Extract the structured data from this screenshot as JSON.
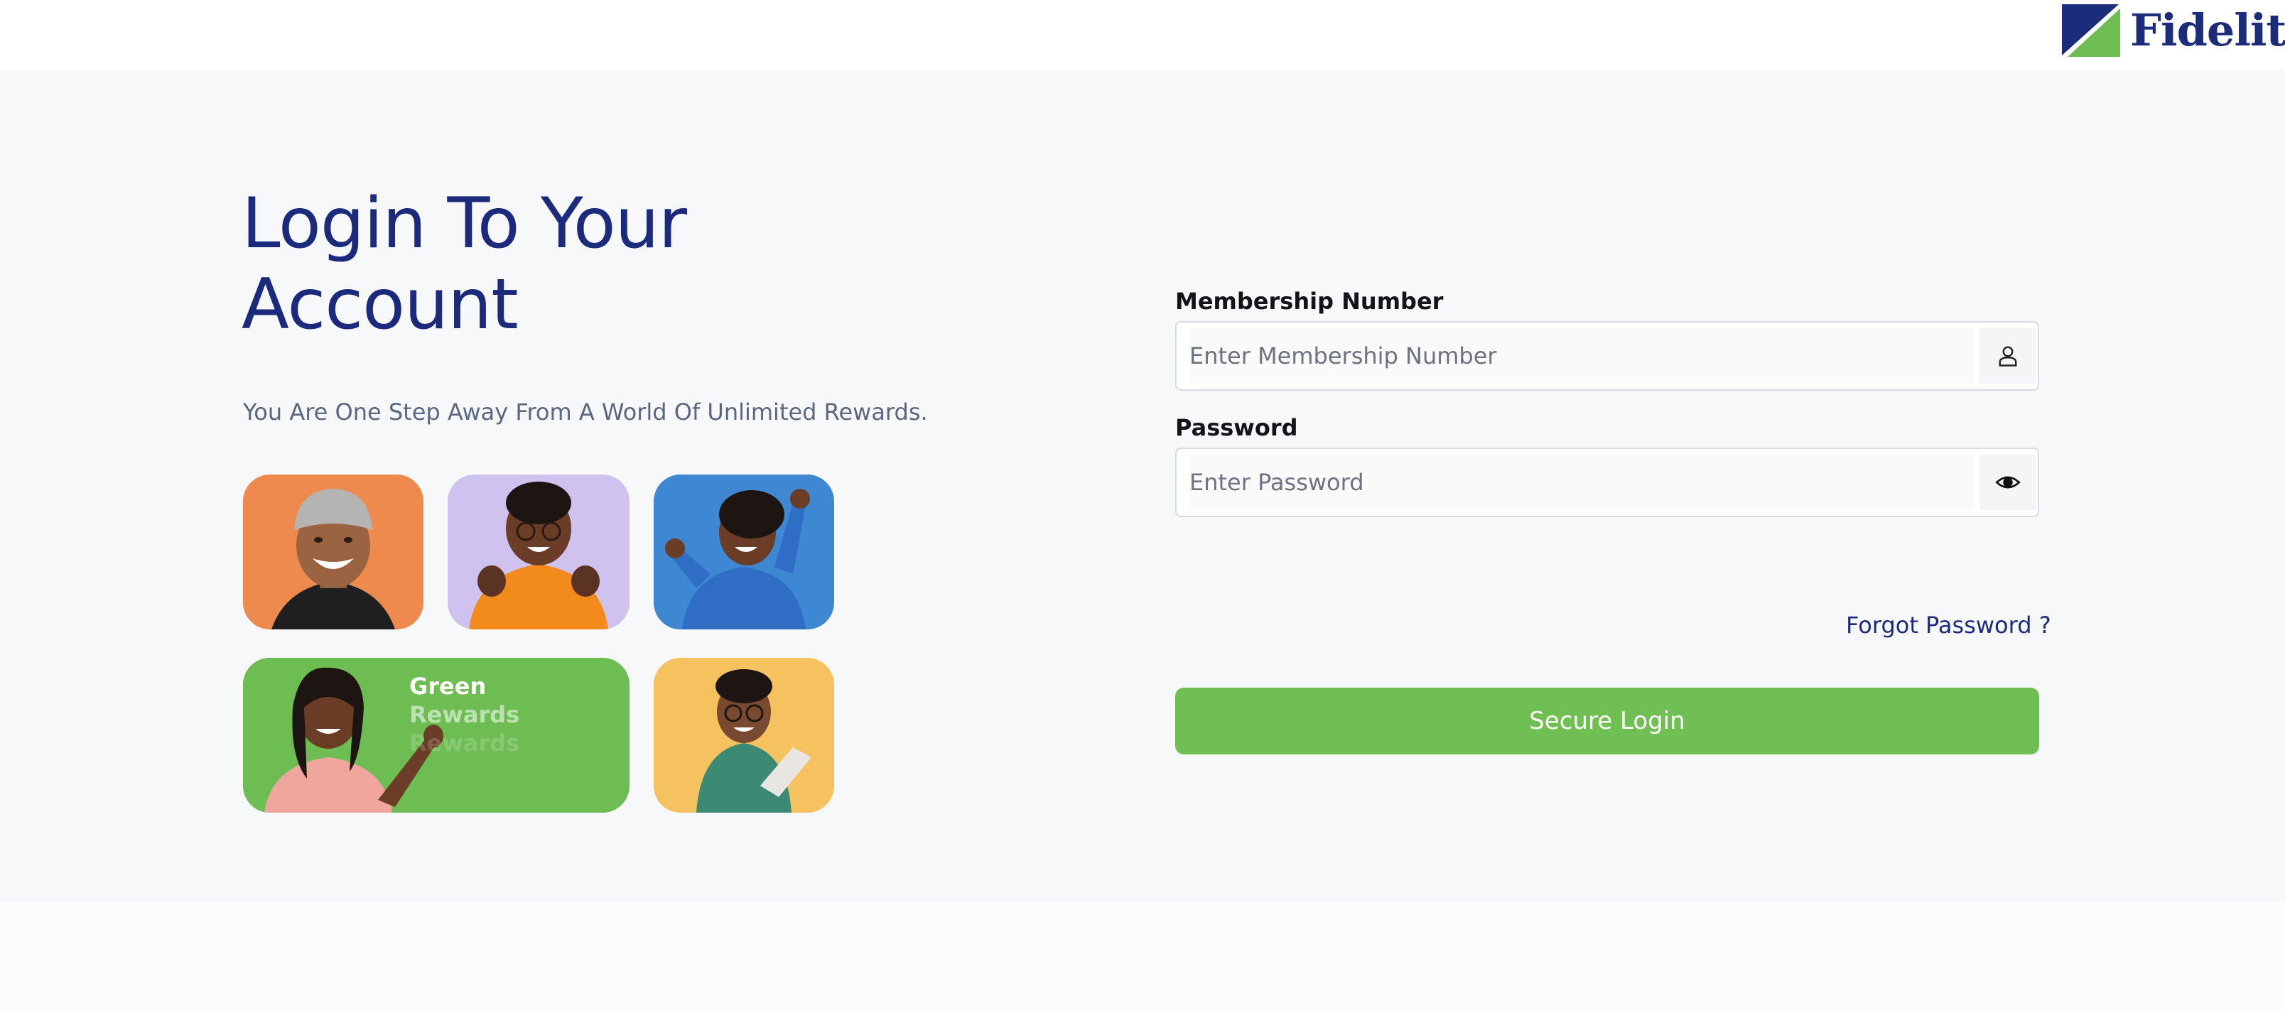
{
  "brand": {
    "name": "Fidelity",
    "colors": {
      "navy": "#1b2a7c",
      "green": "#6fbf52"
    },
    "logo_icon": "fidelity-logo-mark"
  },
  "hero": {
    "title": "Login To Your Account",
    "subtitle": "You Are One Step Away From A World Of Unlimited Rewards."
  },
  "gallery": {
    "tiles": [
      {
        "name": "smiling-man-photo",
        "background": "#ee8a4e"
      },
      {
        "name": "celebrating-woman-photo",
        "background": "#cfc2ee"
      },
      {
        "name": "dancing-woman-photo",
        "background": "#3d87d3"
      },
      {
        "name": "green-rewards-photo",
        "background": "#6dbd52"
      },
      {
        "name": "man-with-laptop-photo",
        "background": "#f6c260"
      }
    ],
    "rewards_text": [
      "Green",
      "Rewards",
      "Rewards"
    ]
  },
  "form": {
    "membership": {
      "label": "Membership Number",
      "placeholder": "Enter Membership Number",
      "value": "",
      "icon": "user-icon"
    },
    "password": {
      "label": "Password",
      "placeholder": "Enter Password",
      "value": "",
      "icon": "eye-icon"
    },
    "forgot_link": "Forgot Password ?",
    "submit_label": "Secure Login"
  }
}
